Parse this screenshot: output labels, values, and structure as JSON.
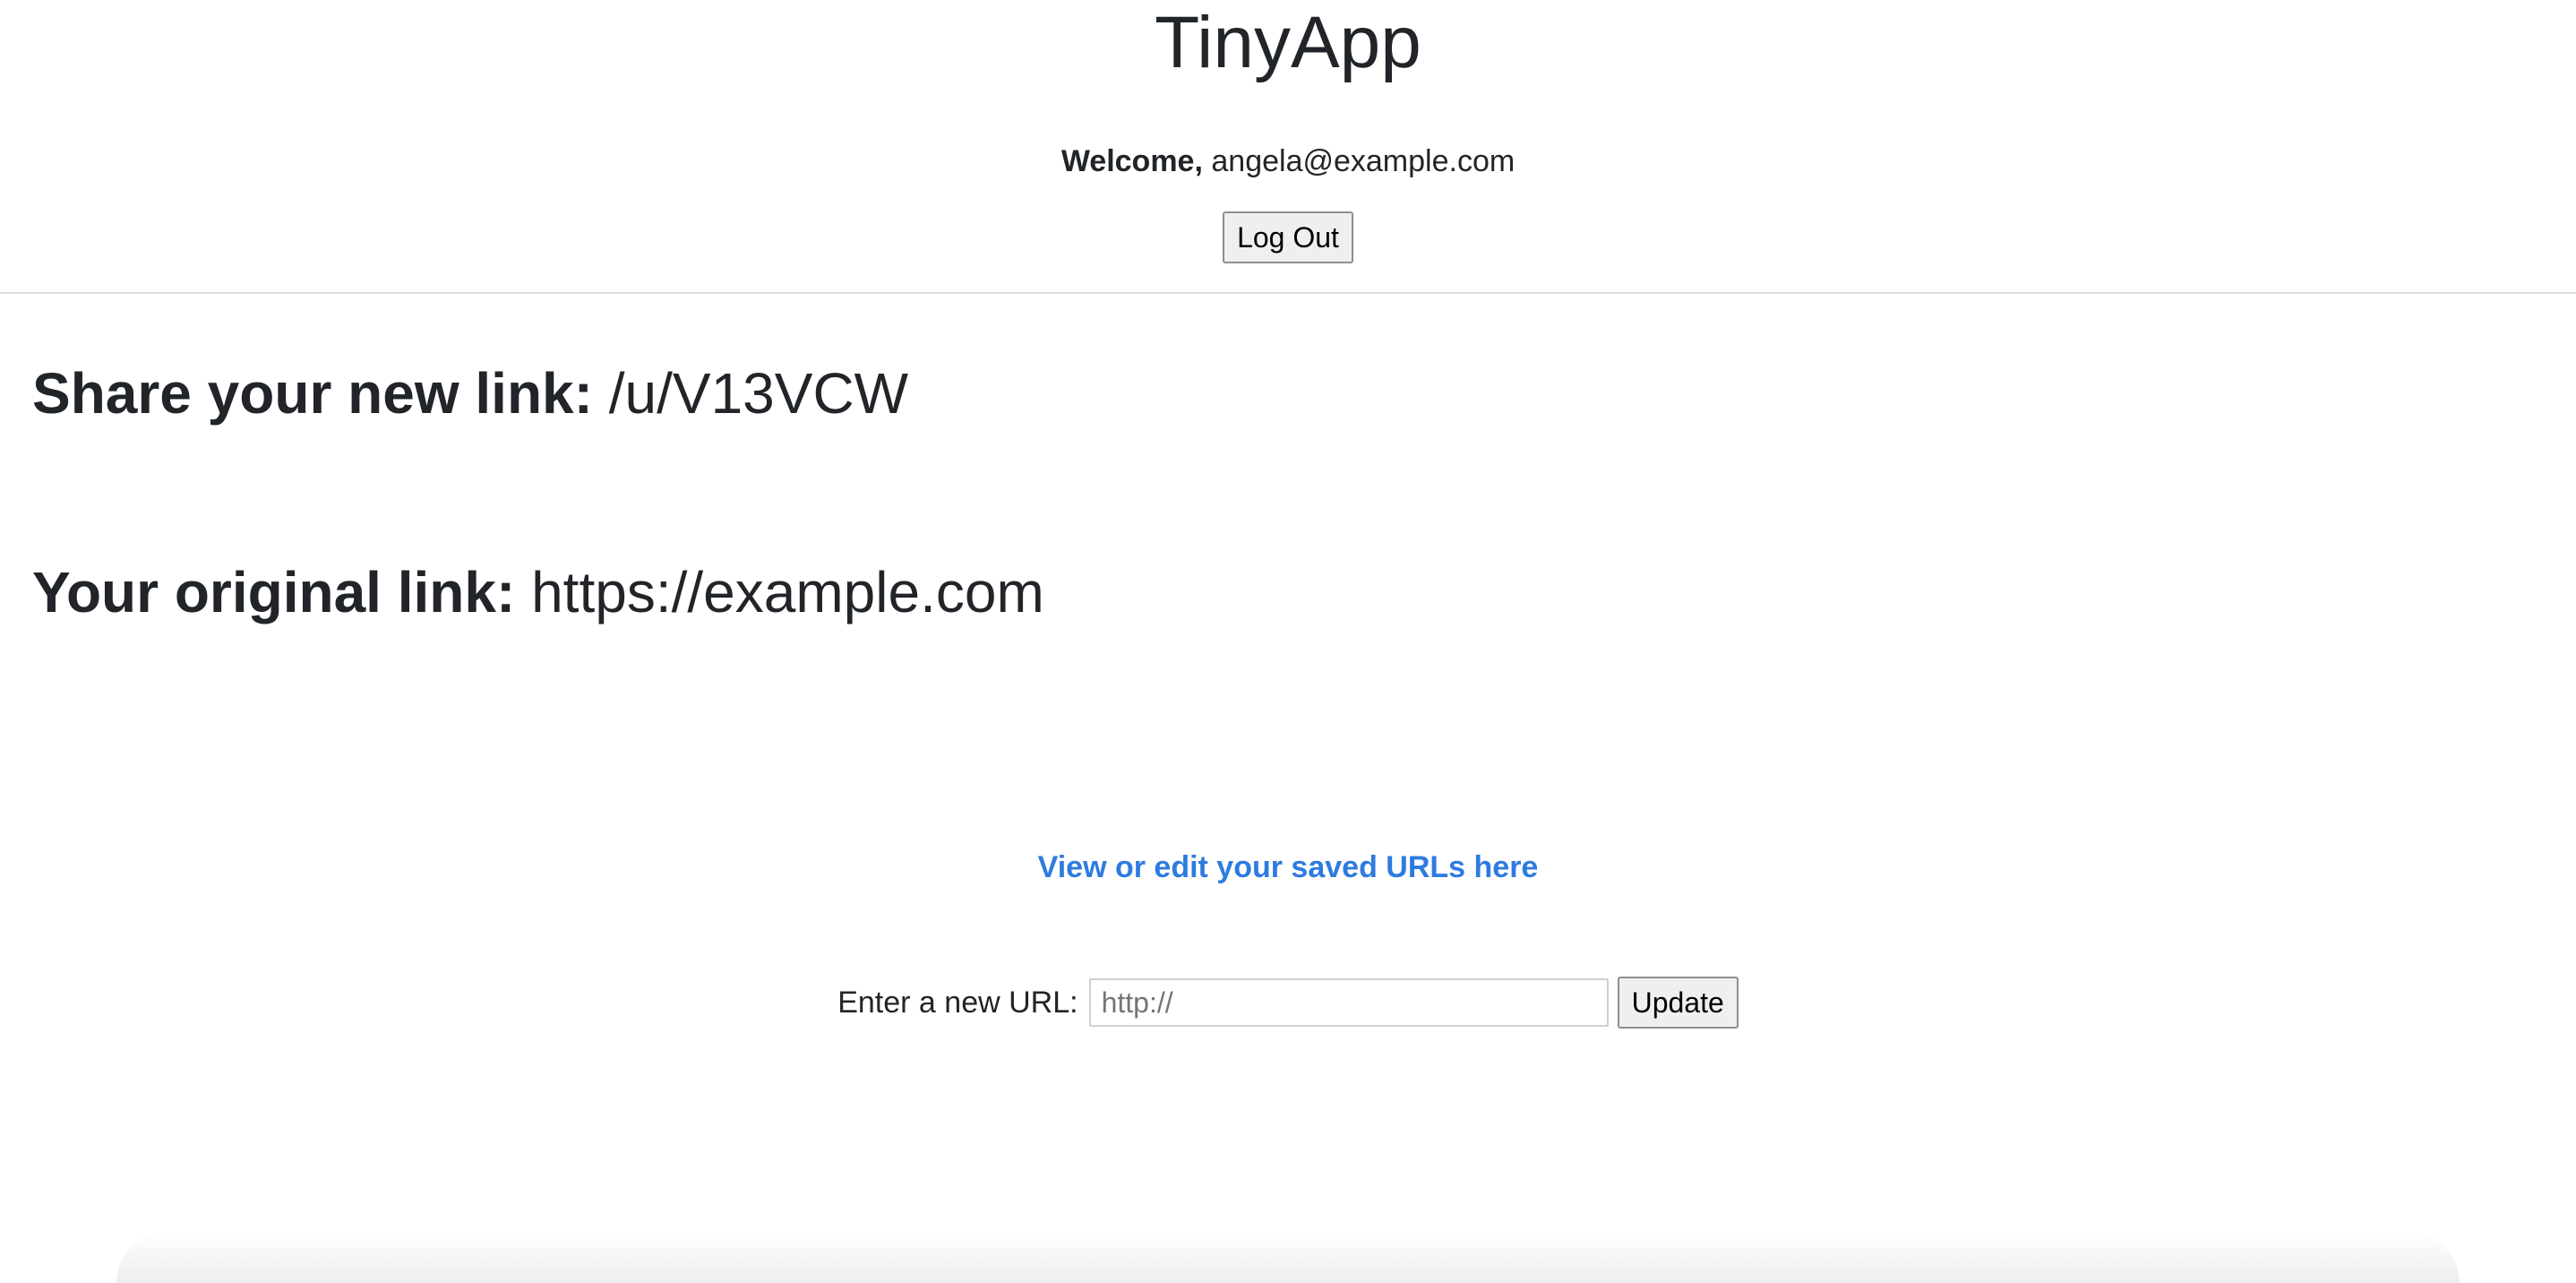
{
  "header": {
    "app_title": "TinyApp",
    "welcome_label": "Welcome,",
    "user_email": "angela@example.com",
    "logout_label": "Log Out"
  },
  "main": {
    "share_label": "Share your new link:",
    "short_link": "/u/V13VCW",
    "original_label": "Your original link:",
    "original_url": "https://example.com",
    "saved_urls_link": "View or edit your saved URLs here"
  },
  "update_form": {
    "label": "Enter a new URL:",
    "input_value": "",
    "input_placeholder": "http://",
    "submit_label": "Update"
  },
  "colors": {
    "link": "#2e7be0",
    "text": "#212529"
  }
}
